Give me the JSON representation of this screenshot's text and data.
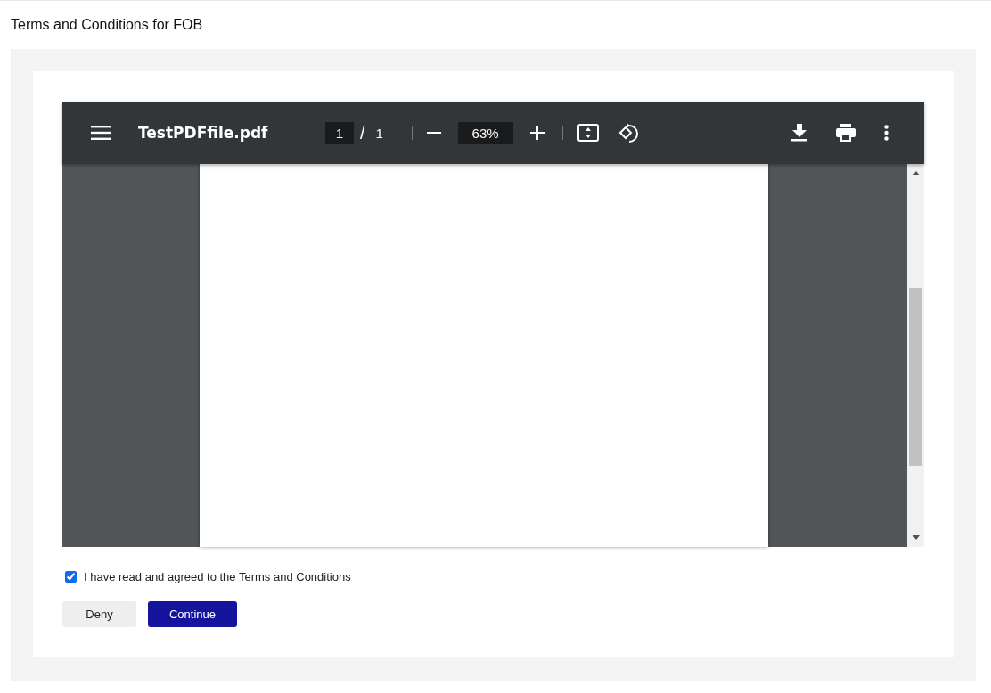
{
  "page_title": "Terms and Conditions for FOB",
  "viewer": {
    "file_name": "TestPDFfile.pdf",
    "page_current": "1",
    "page_separator": "/",
    "page_total": "1",
    "zoom": "63%"
  },
  "agreement": {
    "label": "I have read and agreed to the Terms and Conditions",
    "checked": true
  },
  "buttons": [
    {
      "label": "Deny",
      "kind": "secondary"
    },
    {
      "label": "Continue",
      "kind": "primary"
    }
  ]
}
